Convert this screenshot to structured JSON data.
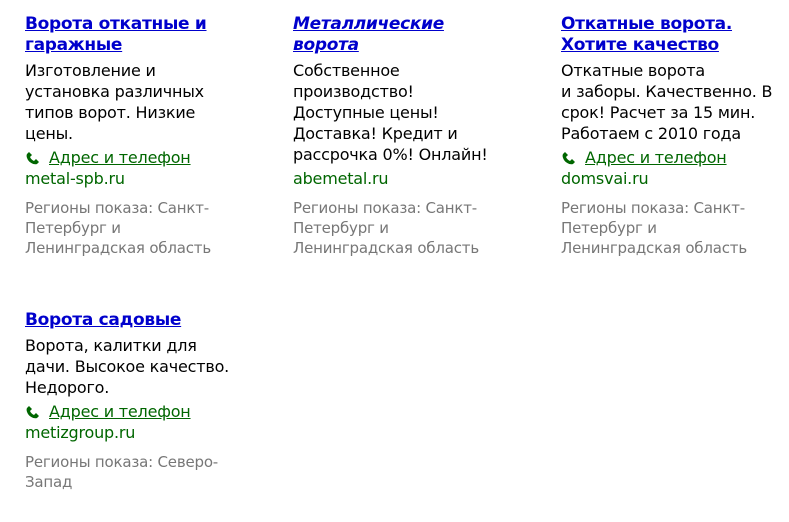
{
  "ads": [
    {
      "title_line1": "Ворота откатные и",
      "title_line2": "гаражные",
      "text_lines": [
        "Изготовление и",
        "установка различных",
        "типов ворот. Низкие",
        "цены."
      ],
      "contact_label": "Адрес и телефон",
      "domain": "metal-spb.ru",
      "regions_lines": [
        "Регионы показа: Санкт-",
        "Петербург и",
        "Ленинградская область"
      ]
    },
    {
      "title_line1": "Металлические",
      "title_line2": "ворота",
      "text_lines": [
        "Собственное",
        "производство!",
        "Доступные цены!",
        "Доставка! Кредит и",
        "рассрочка 0%! Онлайн!"
      ],
      "domain": "abemetal.ru",
      "regions_lines": [
        "Регионы показа: Санкт-",
        "Петербург и",
        "Ленинградская область"
      ]
    },
    {
      "title_line1": "Откатные ворота.",
      "title_line2": "Хотите качество",
      "text_lines": [
        "Откатные ворота",
        "и заборы. Качественно. В",
        "срок! Расчет за 15 мин.",
        "Работаем с 2010 года"
      ],
      "contact_label": "Адрес и телефон",
      "domain": "domsvai.ru",
      "regions_lines": [
        "Регионы показа: Санкт-",
        "Петербург и",
        "Ленинградская область"
      ]
    },
    {
      "title_line1": "Ворота садовые",
      "text_lines": [
        "Ворота, калитки для",
        "дачи. Высокое качество.",
        "Недорого."
      ],
      "contact_label": "Адрес и телефон",
      "domain": "metizgroup.ru",
      "regions_lines": [
        "Регионы показа: Северо-",
        "Запад"
      ]
    }
  ],
  "colors": {
    "title_link": "#0000cc",
    "contact_green": "#006600",
    "regions_gray": "#777777"
  }
}
